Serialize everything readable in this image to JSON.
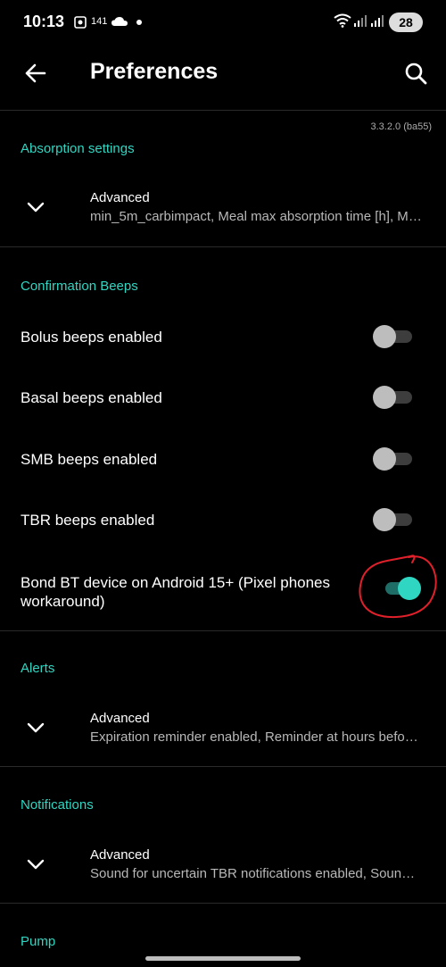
{
  "status_bar": {
    "time": "10:13",
    "notif_count": "141",
    "battery": "28"
  },
  "app_bar": {
    "title": "Preferences",
    "back_icon": "arrow-back-icon",
    "search_icon": "search-icon"
  },
  "version": "3.3.2.0 (ba55)",
  "sections": {
    "absorption": {
      "title": "Absorption settings",
      "advanced_title": "Advanced",
      "advanced_summary": "min_5m_carbimpact, Meal max absorption time [h], Meal assumed absorption"
    },
    "confirmation_beeps": {
      "title": "Confirmation Beeps",
      "items": [
        {
          "label": "Bolus beeps enabled",
          "checked": false
        },
        {
          "label": "Basal beeps enabled",
          "checked": false
        },
        {
          "label": "SMB beeps enabled",
          "checked": false
        },
        {
          "label": "TBR beeps enabled",
          "checked": false
        },
        {
          "label": "Bond BT device on Android 15+ (Pixel phones workaround)",
          "checked": true
        }
      ]
    },
    "alerts": {
      "title": "Alerts",
      "advanced_title": "Advanced",
      "advanced_summary": "Expiration reminder enabled, Reminder at hours before expiration"
    },
    "notifications": {
      "title": "Notifications",
      "advanced_title": "Advanced",
      "advanced_summary": "Sound for uncertain TBR notifications enabled, Sound for SMB"
    },
    "pump": {
      "title": "Pump"
    }
  },
  "colors": {
    "accent": "#2fd6c2",
    "annotation": "#e0202a"
  }
}
